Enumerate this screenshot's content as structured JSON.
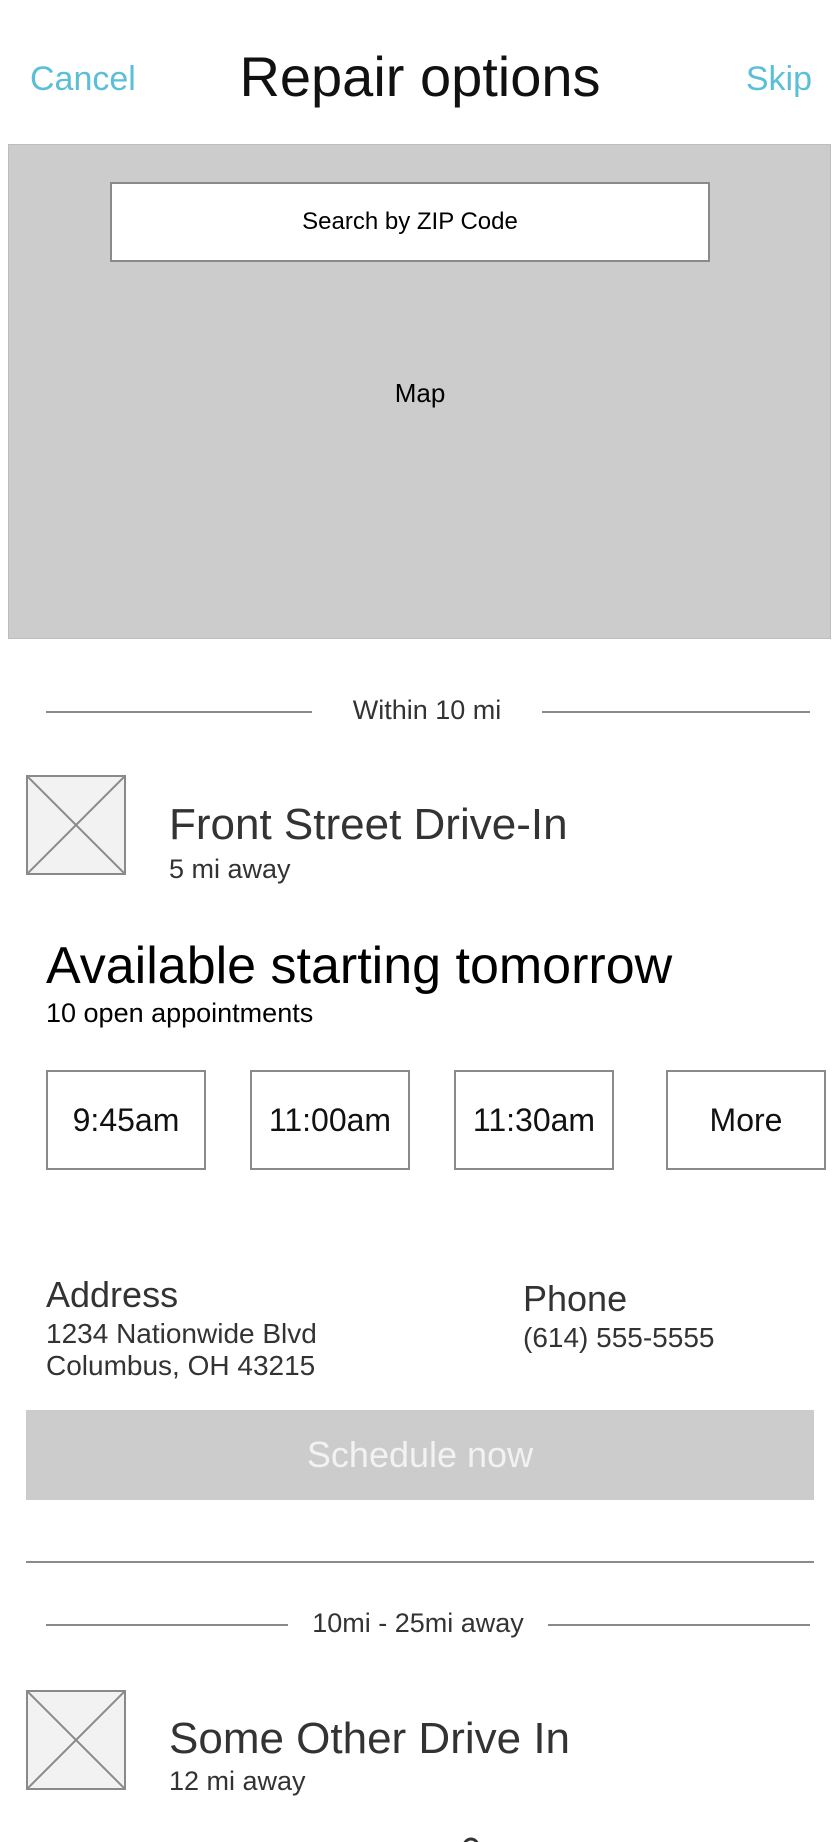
{
  "header": {
    "cancel_label": "Cancel",
    "title": "Repair options",
    "skip_label": "Skip"
  },
  "map": {
    "search_label": "Search by ZIP Code",
    "placeholder_label": "Map"
  },
  "sections": [
    {
      "range_label": "Within 10 mi",
      "shop": {
        "name": "Front Street Drive-In",
        "distance": "5 mi away",
        "availability_title": "Available starting tomorrow",
        "appointments_count": "10 open appointments",
        "time_slots": [
          "9:45am",
          "11:00am",
          "11:30am",
          "More"
        ],
        "address_label": "Address",
        "address_line1": "1234 Nationwide Blvd",
        "address_line2": "Columbus, OH 43215",
        "phone_label": "Phone",
        "phone": "(614) 555-5555",
        "schedule_label": "Schedule now"
      }
    },
    {
      "range_label": "10mi - 25mi away",
      "shop": {
        "name": "Some Other Drive In",
        "distance": "12 mi away"
      }
    }
  ],
  "colors": {
    "link": "#5bbfd8",
    "map_background": "#cccccc",
    "disabled_button": "#cccccc",
    "disabled_button_text": "#f2f2f2",
    "border": "#8a8a8a"
  },
  "icons": {
    "shop_thumbnail": "image-placeholder-icon"
  }
}
